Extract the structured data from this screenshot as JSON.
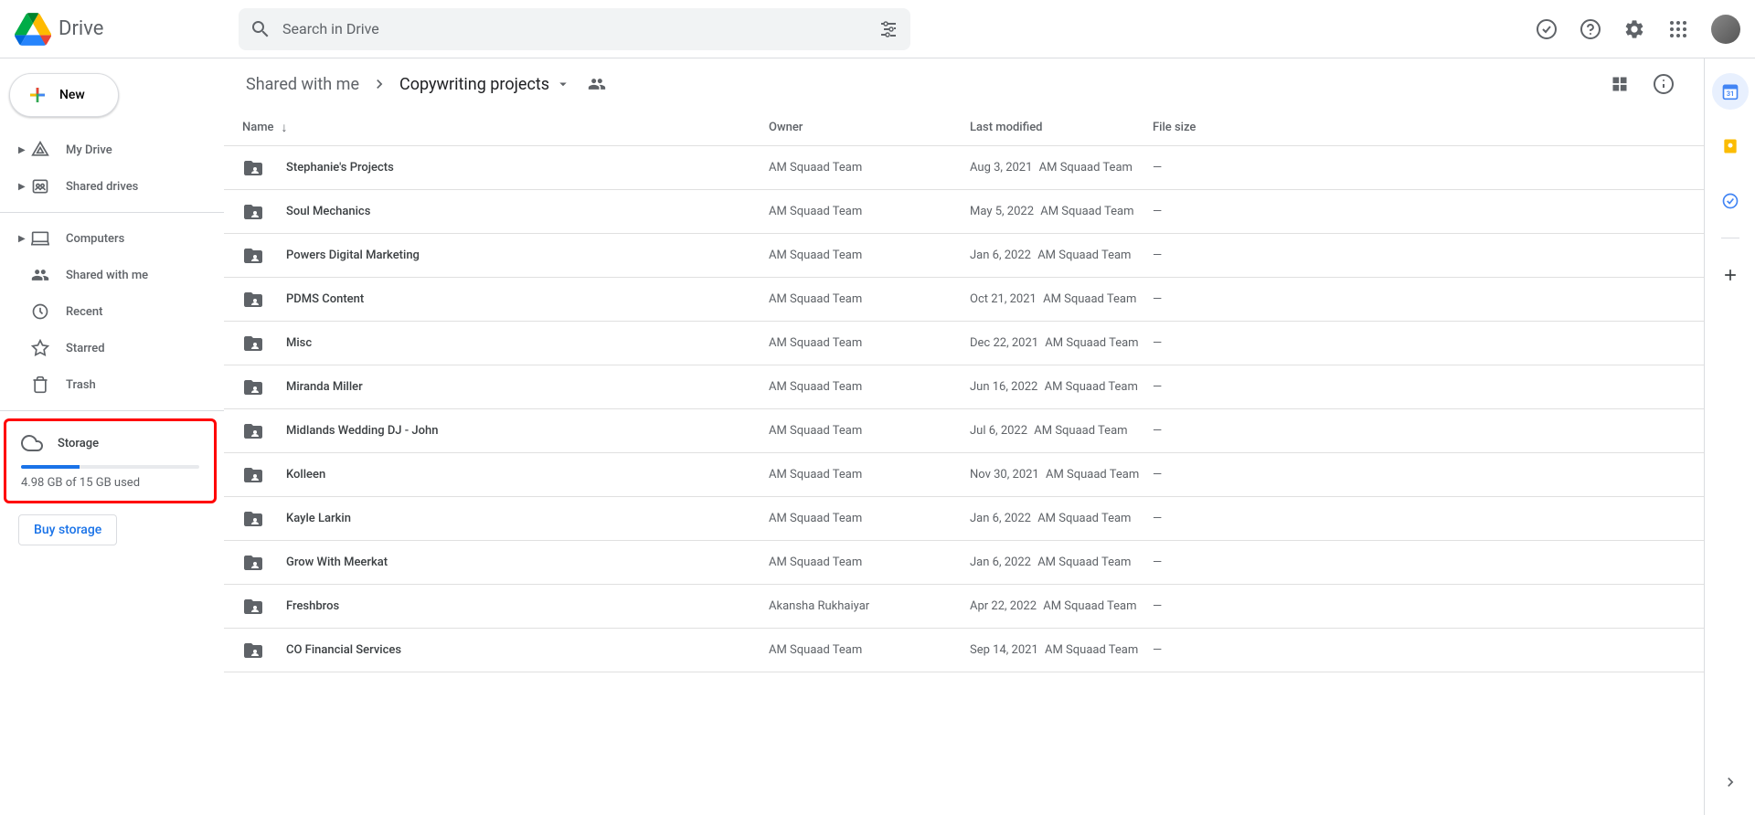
{
  "app_name": "Drive",
  "search": {
    "placeholder": "Search in Drive"
  },
  "sidebar": {
    "new_label": "New",
    "items": [
      {
        "label": "My Drive",
        "expandable": true
      },
      {
        "label": "Shared drives",
        "expandable": true
      }
    ],
    "items2": [
      {
        "label": "Computers",
        "expandable": true
      },
      {
        "label": "Shared with me",
        "expandable": false
      },
      {
        "label": "Recent",
        "expandable": false
      },
      {
        "label": "Starred",
        "expandable": false
      },
      {
        "label": "Trash",
        "expandable": false
      }
    ],
    "storage": {
      "label": "Storage",
      "text": "4.98 GB of 15 GB used",
      "percent": 33,
      "buy_label": "Buy storage"
    }
  },
  "breadcrumbs": {
    "parent": "Shared with me",
    "current": "Copywriting projects"
  },
  "columns": {
    "name": "Name",
    "owner": "Owner",
    "modified": "Last modified",
    "size": "File size"
  },
  "rows": [
    {
      "name": "Stephanie's Projects",
      "owner": "AM Squaad Team",
      "date": "Aug 3, 2021",
      "by": "AM Squaad Team",
      "size": "—"
    },
    {
      "name": "Soul Mechanics",
      "owner": "AM Squaad Team",
      "date": "May 5, 2022",
      "by": "AM Squaad Team",
      "size": "—"
    },
    {
      "name": "Powers Digital Marketing",
      "owner": "AM Squaad Team",
      "date": "Jan 6, 2022",
      "by": "AM Squaad Team",
      "size": "—"
    },
    {
      "name": "PDMS Content",
      "owner": "AM Squaad Team",
      "date": "Oct 21, 2021",
      "by": "AM Squaad Team",
      "size": "—"
    },
    {
      "name": "Misc",
      "owner": "AM Squaad Team",
      "date": "Dec 22, 2021",
      "by": "AM Squaad Team",
      "size": "—"
    },
    {
      "name": "Miranda Miller",
      "owner": "AM Squaad Team",
      "date": "Jun 16, 2022",
      "by": "AM Squaad Team",
      "size": "—"
    },
    {
      "name": "Midlands Wedding DJ - John",
      "owner": "AM Squaad Team",
      "date": "Jul 6, 2022",
      "by": "AM Squaad Team",
      "size": "—"
    },
    {
      "name": "Kolleen",
      "owner": "AM Squaad Team",
      "date": "Nov 30, 2021",
      "by": "AM Squaad Team",
      "size": "—"
    },
    {
      "name": "Kayle Larkin",
      "owner": "AM Squaad Team",
      "date": "Jan 6, 2022",
      "by": "AM Squaad Team",
      "size": "—"
    },
    {
      "name": "Grow With Meerkat",
      "owner": "AM Squaad Team",
      "date": "Jan 6, 2022",
      "by": "AM Squaad Team",
      "size": "—"
    },
    {
      "name": "Freshbros",
      "owner": "Akansha Rukhaiyar",
      "date": "Apr 22, 2022",
      "by": "AM Squaad Team",
      "size": "—"
    },
    {
      "name": "CO Financial Services",
      "owner": "AM Squaad Team",
      "date": "Sep 14, 2021",
      "by": "AM Squaad Team",
      "size": "—"
    }
  ]
}
